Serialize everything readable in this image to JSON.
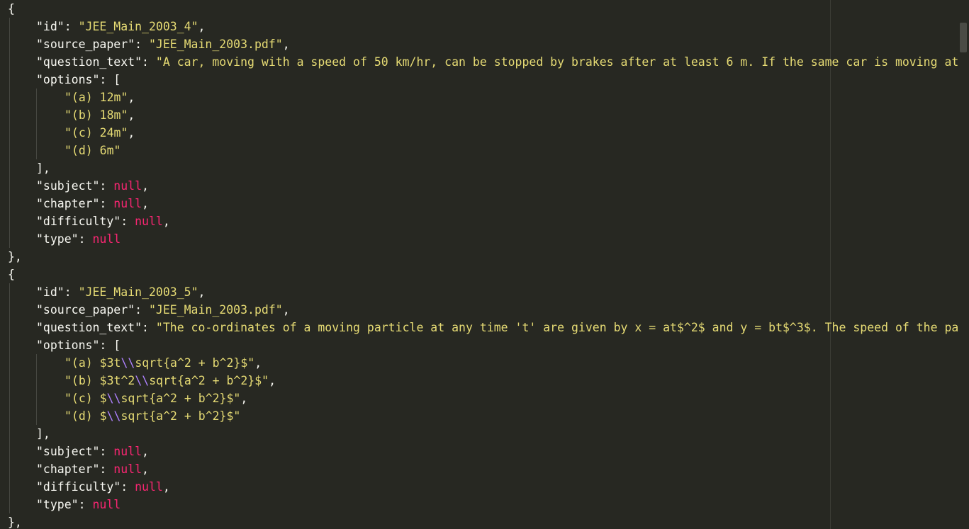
{
  "colors": {
    "background": "#272822",
    "string": "#e6db74",
    "null_keyword": "#f92672",
    "escape": "#ae81ff",
    "plain": "#f8f8f2"
  },
  "records": [
    {
      "id_key": "\"id\"",
      "id_value": "\"JEE_Main_2003_4\"",
      "source_key": "\"source_paper\"",
      "source_value": "\"JEE_Main_2003.pdf\"",
      "question_key": "\"question_text\"",
      "question_value": "\"A car, moving with a speed of 50 km/hr, can be stopped by brakes after at least 6 m. If the same car is moving at",
      "options_key": "\"options\"",
      "options": [
        {
          "text": "\"(a) 12m\"",
          "suffix": ","
        },
        {
          "text": "\"(b) 18m\"",
          "suffix": ","
        },
        {
          "text": "\"(c) 24m\"",
          "suffix": ","
        },
        {
          "text": "\"(d) 6m\"",
          "suffix": ""
        }
      ],
      "subject_key": "\"subject\"",
      "chapter_key": "\"chapter\"",
      "difficulty_key": "\"difficulty\"",
      "type_key": "\"type\"",
      "null_text": "null"
    },
    {
      "id_key": "\"id\"",
      "id_value": "\"JEE_Main_2003_5\"",
      "source_key": "\"source_paper\"",
      "source_value": "\"JEE_Main_2003.pdf\"",
      "question_key": "\"question_text\"",
      "question_value": "\"The co-ordinates of a moving particle at any time 't' are given by x = at$^2$ and y = bt$^3$. The speed of the par",
      "options_key": "\"options\"",
      "options": [
        {
          "pre": "\"(a) $3t",
          "esc": "\\\\",
          "post": "sqrt{a^2 + b^2}$\"",
          "suffix": ","
        },
        {
          "pre": "\"(b) $3t^2",
          "esc": "\\\\",
          "post": "sqrt{a^2 + b^2}$\"",
          "suffix": ","
        },
        {
          "pre": "\"(c) $",
          "esc": "\\\\",
          "post": "sqrt{a^2 + b^2}$\"",
          "suffix": ","
        },
        {
          "pre": "\"(d) $",
          "esc": "\\\\",
          "post": "sqrt{a^2 + b^2}$\"",
          "suffix": ""
        }
      ],
      "subject_key": "\"subject\"",
      "chapter_key": "\"chapter\"",
      "difficulty_key": "\"difficulty\"",
      "type_key": "\"type\"",
      "null_text": "null"
    }
  ],
  "punct": {
    "open_brace": "{",
    "close_brace_comma": "},",
    "open_bracket": "[",
    "close_bracket_comma": "],",
    "colon": ": ",
    "comma": ","
  }
}
